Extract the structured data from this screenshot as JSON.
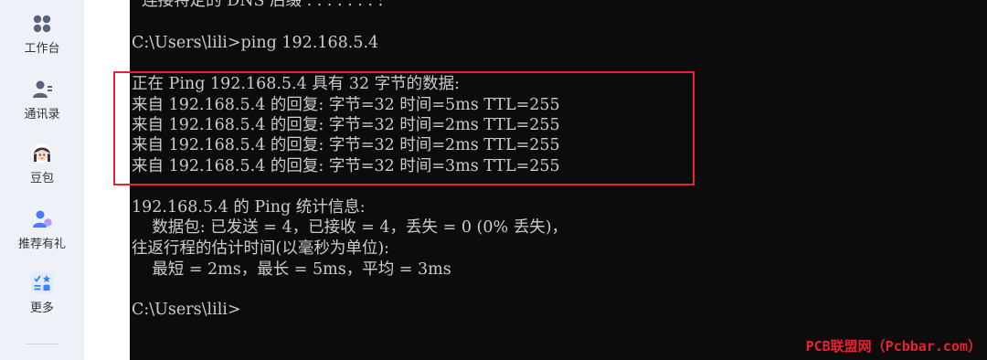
{
  "sidebar": {
    "items": [
      {
        "label": "工作台",
        "icon": "grid-icon"
      },
      {
        "label": "通讯录",
        "icon": "contacts-icon"
      },
      {
        "label": "豆包",
        "icon": "doubao-avatar-icon"
      },
      {
        "label": "推荐有礼",
        "icon": "referral-icon"
      },
      {
        "label": "更多",
        "icon": "more-apps-icon"
      }
    ]
  },
  "terminal": {
    "lines": [
      "  连接特定的 DNS 后缀 . . . . . . . :",
      "",
      "C:\\Users\\lili>ping 192.168.5.4",
      "",
      "正在 Ping 192.168.5.4 具有 32 字节的数据:",
      "来自 192.168.5.4 的回复: 字节=32 时间=5ms TTL=255",
      "来自 192.168.5.4 的回复: 字节=32 时间=2ms TTL=255",
      "来自 192.168.5.4 的回复: 字节=32 时间=2ms TTL=255",
      "来自 192.168.5.4 的回复: 字节=32 时间=3ms TTL=255",
      "",
      "192.168.5.4 的 Ping 统计信息:",
      "    数据包: 已发送 = 4，已接收 = 4，丢失 = 0 (0% 丢失)，",
      "往返行程的估计时间(以毫秒为单位):",
      "    最短 = 2ms，最长 = 5ms，平均 = 3ms",
      "",
      "C:\\Users\\lili>"
    ]
  },
  "watermark": "PCB联盟网（Pcbbar.com）",
  "colors": {
    "highlight_border": "#e8232f",
    "terminal_bg": "#0c0c0c",
    "terminal_text": "#cccccc",
    "sidebar_bg": "#eef1f7"
  }
}
